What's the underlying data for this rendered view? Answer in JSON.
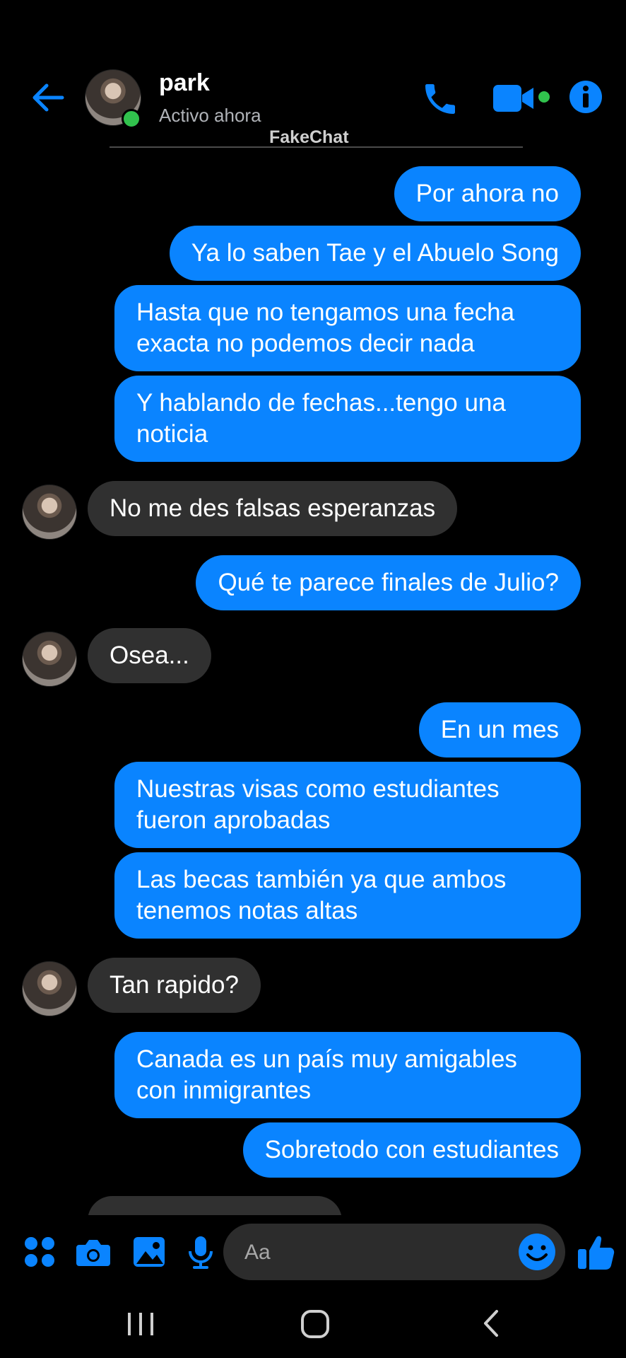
{
  "header": {
    "contact_name": "park",
    "status": "Activo ahora",
    "watermark": "FakeChat",
    "icons": [
      "back-arrow-icon",
      "phone-icon",
      "video-camera-icon",
      "info-icon"
    ]
  },
  "messages": [
    {
      "dir": "out",
      "text": "Por ahora no"
    },
    {
      "dir": "out",
      "text": "Ya lo saben Tae y el Abuelo Song"
    },
    {
      "dir": "out",
      "text": "Hasta que no tengamos una fecha exacta no podemos decir nada"
    },
    {
      "dir": "out",
      "text": "Y hablando de fechas...tengo una noticia"
    },
    {
      "dir": "in",
      "text": "No me des falsas esperanzas"
    },
    {
      "dir": "out",
      "text": "Qué te parece finales de Julio?"
    },
    {
      "dir": "in",
      "text": "Osea..."
    },
    {
      "dir": "out",
      "text": "En un mes"
    },
    {
      "dir": "out",
      "text": "Nuestras visas como estudiantes fueron aprobadas"
    },
    {
      "dir": "out",
      "text": "Las becas también ya que ambos tenemos notas altas"
    },
    {
      "dir": "in",
      "text": "Tan rapido?"
    },
    {
      "dir": "out",
      "text": "Canada es un país muy amigables con inmigrantes"
    },
    {
      "dir": "out",
      "text": "Sobretodo con estudiantes"
    }
  ],
  "input_bar": {
    "placeholder": "Aa",
    "icons": [
      "apps-grid-icon",
      "camera-icon",
      "image-icon",
      "microphone-icon",
      "emoji-icon",
      "thumbs-up-icon"
    ]
  },
  "nav_bar": {
    "icons": [
      "recent-apps-icon",
      "home-icon",
      "back-icon"
    ]
  },
  "colors": {
    "background": "#000000",
    "accent": "#0a84ff",
    "incoming_bubble": "#303030",
    "online": "#31c24d"
  }
}
